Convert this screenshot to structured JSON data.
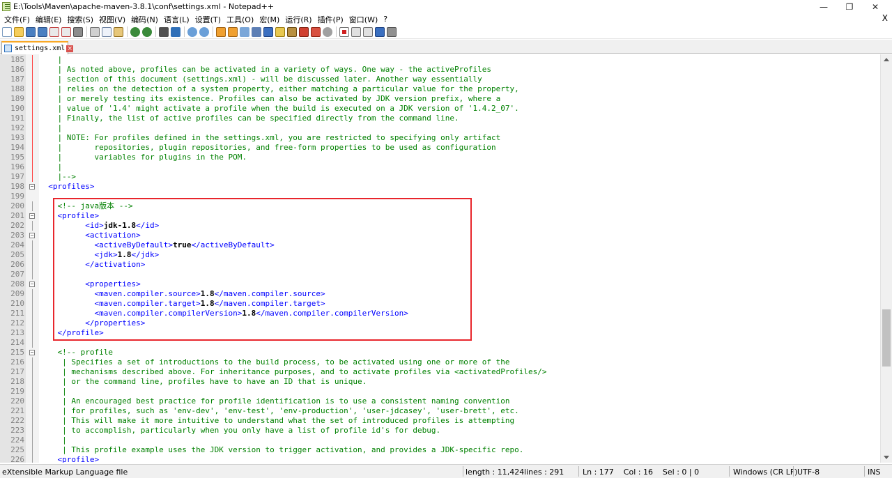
{
  "window": {
    "title": "E:\\Tools\\Maven\\apache-maven-3.8.1\\conf\\settings.xml - Notepad++",
    "minimize": "—",
    "maximize": "❐",
    "close": "✕"
  },
  "menu": {
    "items": [
      "文件(F)",
      "编辑(E)",
      "搜索(S)",
      "视图(V)",
      "编码(N)",
      "语言(L)",
      "设置(T)",
      "工具(O)",
      "宏(M)",
      "运行(R)",
      "插件(P)",
      "窗口(W)",
      "?"
    ],
    "close": "X"
  },
  "toolbar": {
    "icons": [
      "new-file-icon",
      "open-file-icon",
      "save-icon",
      "save-all-icon",
      "close-icon",
      "close-all-icon",
      "print-icon",
      "cut-icon",
      "copy-icon",
      "paste-icon",
      "undo-icon",
      "redo-icon",
      "find-icon",
      "replace-icon",
      "zoom-in-icon",
      "zoom-out-icon",
      "sync-vertical-icon",
      "sync-horizontal-icon",
      "word-wrap-icon",
      "show-all-chars-icon",
      "indent-guide-icon",
      "doc-map-icon",
      "function-list-icon",
      "folder-workspace-icon",
      "monitoring-icon",
      "record-macro-icon",
      "stop-macro-icon",
      "play-macro-icon",
      "run-macro-multiple-icon",
      "save-macro-icon"
    ]
  },
  "tab": {
    "label": "settings.xml",
    "close": "×"
  },
  "editor": {
    "lines": [
      {
        "n": "185",
        "parts": [
          {
            "c": "c",
            "t": "    |"
          }
        ]
      },
      {
        "n": "186",
        "parts": [
          {
            "c": "c",
            "t": "    | As noted above, profiles can be activated in a variety of ways. One way - the activeProfiles"
          }
        ]
      },
      {
        "n": "187",
        "parts": [
          {
            "c": "c",
            "t": "    | section of this document (settings.xml) - will be discussed later. Another way essentially"
          }
        ]
      },
      {
        "n": "188",
        "parts": [
          {
            "c": "c",
            "t": "    | relies on the detection of a system property, either matching a particular value for the property,"
          }
        ]
      },
      {
        "n": "189",
        "parts": [
          {
            "c": "c",
            "t": "    | or merely testing its existence. Profiles can also be activated by JDK version prefix, where a"
          }
        ]
      },
      {
        "n": "190",
        "parts": [
          {
            "c": "c",
            "t": "    | value of '1.4' might activate a profile when the build is executed on a JDK version of '1.4.2_07'."
          }
        ]
      },
      {
        "n": "191",
        "parts": [
          {
            "c": "c",
            "t": "    | Finally, the list of active profiles can be specified directly from the command line."
          }
        ]
      },
      {
        "n": "192",
        "parts": [
          {
            "c": "c",
            "t": "    |"
          }
        ]
      },
      {
        "n": "193",
        "parts": [
          {
            "c": "c",
            "t": "    | NOTE: For profiles defined in the settings.xml, you are restricted to specifying only artifact"
          }
        ]
      },
      {
        "n": "194",
        "parts": [
          {
            "c": "c",
            "t": "    |       repositories, plugin repositories, and free-form properties to be used as configuration"
          }
        ]
      },
      {
        "n": "195",
        "parts": [
          {
            "c": "c",
            "t": "    |       variables for plugins in the POM."
          }
        ]
      },
      {
        "n": "196",
        "parts": [
          {
            "c": "c",
            "t": "    |"
          }
        ]
      },
      {
        "n": "197",
        "parts": [
          {
            "c": "c",
            "t": "    |-->"
          }
        ]
      },
      {
        "n": "198",
        "parts": [
          {
            "c": "t",
            "t": "  <profiles>"
          }
        ]
      },
      {
        "n": "199",
        "parts": []
      },
      {
        "n": "200",
        "parts": [
          {
            "c": "c",
            "t": "    <!-- java版本 -->"
          }
        ]
      },
      {
        "n": "201",
        "parts": [
          {
            "c": "t",
            "t": "    <profile>"
          }
        ]
      },
      {
        "n": "202",
        "parts": [
          {
            "c": "t",
            "t": "          <id>"
          },
          {
            "c": "v",
            "t": "jdk-1.8"
          },
          {
            "c": "t",
            "t": "</id>"
          }
        ]
      },
      {
        "n": "203",
        "parts": [
          {
            "c": "t",
            "t": "          <activation>"
          }
        ]
      },
      {
        "n": "204",
        "parts": [
          {
            "c": "t",
            "t": "            <activeByDefault>"
          },
          {
            "c": "v",
            "t": "true"
          },
          {
            "c": "t",
            "t": "</activeByDefault>"
          }
        ]
      },
      {
        "n": "205",
        "parts": [
          {
            "c": "t",
            "t": "            <jdk>"
          },
          {
            "c": "v",
            "t": "1.8"
          },
          {
            "c": "t",
            "t": "</jdk>"
          }
        ]
      },
      {
        "n": "206",
        "parts": [
          {
            "c": "t",
            "t": "          </activation>"
          }
        ]
      },
      {
        "n": "207",
        "parts": []
      },
      {
        "n": "208",
        "parts": [
          {
            "c": "t",
            "t": "          <properties>"
          }
        ]
      },
      {
        "n": "209",
        "parts": [
          {
            "c": "t",
            "t": "            <maven.compiler.source>"
          },
          {
            "c": "v",
            "t": "1.8"
          },
          {
            "c": "t",
            "t": "</maven.compiler.source>"
          }
        ]
      },
      {
        "n": "210",
        "parts": [
          {
            "c": "t",
            "t": "            <maven.compiler.target>"
          },
          {
            "c": "v",
            "t": "1.8"
          },
          {
            "c": "t",
            "t": "</maven.compiler.target>"
          }
        ]
      },
      {
        "n": "211",
        "parts": [
          {
            "c": "t",
            "t": "            <maven.compiler.compilerVersion>"
          },
          {
            "c": "v",
            "t": "1.8"
          },
          {
            "c": "t",
            "t": "</maven.compiler.compilerVersion>"
          }
        ]
      },
      {
        "n": "212",
        "parts": [
          {
            "c": "t",
            "t": "          </properties>"
          }
        ]
      },
      {
        "n": "213",
        "parts": [
          {
            "c": "t",
            "t": "    </profile>"
          }
        ]
      },
      {
        "n": "214",
        "parts": []
      },
      {
        "n": "215",
        "parts": [
          {
            "c": "c",
            "t": "    <!-- profile"
          }
        ]
      },
      {
        "n": "216",
        "parts": [
          {
            "c": "c",
            "t": "     | Specifies a set of introductions to the build process, to be activated using one or more of the"
          }
        ]
      },
      {
        "n": "217",
        "parts": [
          {
            "c": "c",
            "t": "     | mechanisms described above. For inheritance purposes, and to activate profiles via <activatedProfiles/>"
          }
        ]
      },
      {
        "n": "218",
        "parts": [
          {
            "c": "c",
            "t": "     | or the command line, profiles have to have an ID that is unique."
          }
        ]
      },
      {
        "n": "219",
        "parts": [
          {
            "c": "c",
            "t": "     |"
          }
        ]
      },
      {
        "n": "220",
        "parts": [
          {
            "c": "c",
            "t": "     | An encouraged best practice for profile identification is to use a consistent naming convention"
          }
        ]
      },
      {
        "n": "221",
        "parts": [
          {
            "c": "c",
            "t": "     | for profiles, such as 'env-dev', 'env-test', 'env-production', 'user-jdcasey', 'user-brett', etc."
          }
        ]
      },
      {
        "n": "222",
        "parts": [
          {
            "c": "c",
            "t": "     | This will make it more intuitive to understand what the set of introduced profiles is attempting"
          }
        ]
      },
      {
        "n": "223",
        "parts": [
          {
            "c": "c",
            "t": "     | to accomplish, particularly when you only have a list of profile id's for debug."
          }
        ]
      },
      {
        "n": "224",
        "parts": [
          {
            "c": "c",
            "t": "     |"
          }
        ]
      },
      {
        "n": "225",
        "parts": [
          {
            "c": "c",
            "t": "     | This profile example uses the JDK version to trigger activation, and provides a JDK-specific repo."
          }
        ]
      },
      {
        "n": "226",
        "parts": [
          {
            "c": "t",
            "t": "    <profile>"
          }
        ]
      }
    ]
  },
  "status": {
    "file_type": "eXtensible Markup Language file",
    "length": "length : 11,424",
    "lines": "lines : 291",
    "position": "Ln : 177    Col : 16    Sel : 0 | 0",
    "eol": "Windows (CR LF)",
    "encoding": "UTF-8",
    "mode": "INS"
  },
  "colors": {
    "comment": "#008000",
    "tag": "#0000ff",
    "highlight_box": "#e8262c",
    "tab_accent": "#f9a825"
  }
}
